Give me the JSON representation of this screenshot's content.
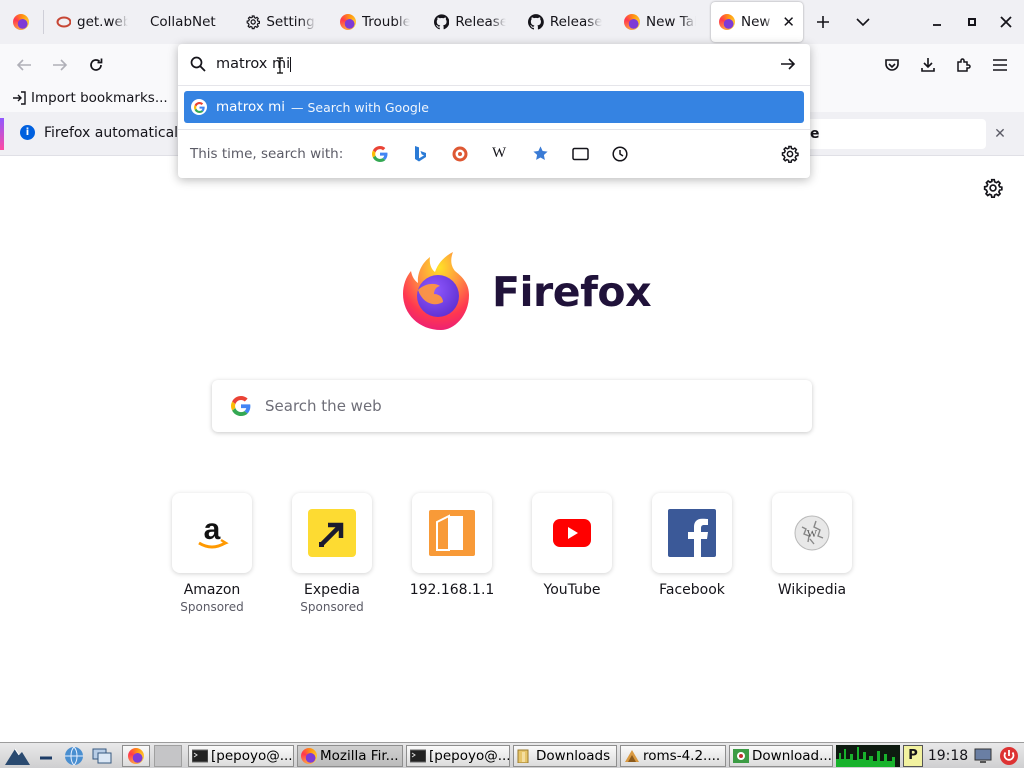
{
  "tabs": [
    {
      "label": "",
      "icon": "firefox-icon"
    },
    {
      "label": "get.web",
      "icon": "oracle-icon"
    },
    {
      "label": "CollabNet",
      "icon": "none"
    },
    {
      "label": "Settings",
      "icon": "gear-icon"
    },
    {
      "label": "Troubles",
      "icon": "firefox-icon"
    },
    {
      "label": "Release",
      "icon": "github-icon"
    },
    {
      "label": "Release",
      "icon": "github-icon"
    },
    {
      "label": "New Tab",
      "icon": "firefox-icon"
    },
    {
      "label": "New Tab",
      "icon": "firefox-icon"
    }
  ],
  "urlbar": {
    "value": "matrox mi"
  },
  "suggestion": {
    "text": "matrox mi",
    "action": "— Search with Google"
  },
  "one_off": {
    "label": "This time, search with:"
  },
  "bookmarks": {
    "import_label": "Import bookmarks..."
  },
  "notification": {
    "text": "Firefox automatically",
    "button_fragment": "e"
  },
  "brand": {
    "wordmark": "Firefox"
  },
  "search": {
    "placeholder": "Search the web"
  },
  "top_sites": [
    {
      "name": "Amazon",
      "sponsored": "Sponsored"
    },
    {
      "name": "Expedia",
      "sponsored": "Sponsored"
    },
    {
      "name": "192.168.1.1",
      "sponsored": ""
    },
    {
      "name": "YouTube",
      "sponsored": ""
    },
    {
      "name": "Facebook",
      "sponsored": ""
    },
    {
      "name": "Wikipedia",
      "sponsored": ""
    }
  ],
  "taskbar": {
    "tasks": [
      {
        "label": "[pepoyo@...",
        "icon": "terminal-icon"
      },
      {
        "label": "Mozilla Fir...",
        "icon": "firefox-icon"
      },
      {
        "label": "[pepoyo@...",
        "icon": "terminal-icon"
      },
      {
        "label": "Downloads",
        "icon": "folder-icon"
      },
      {
        "label": "roms-4.2....",
        "icon": "archive-icon"
      },
      {
        "label": "Download...",
        "icon": "download-manager-icon"
      }
    ],
    "clock": "19:18"
  },
  "colors": {
    "accent": "#3583e2",
    "tabbar": "#f0f0f4",
    "wordmark": "#20123a"
  }
}
